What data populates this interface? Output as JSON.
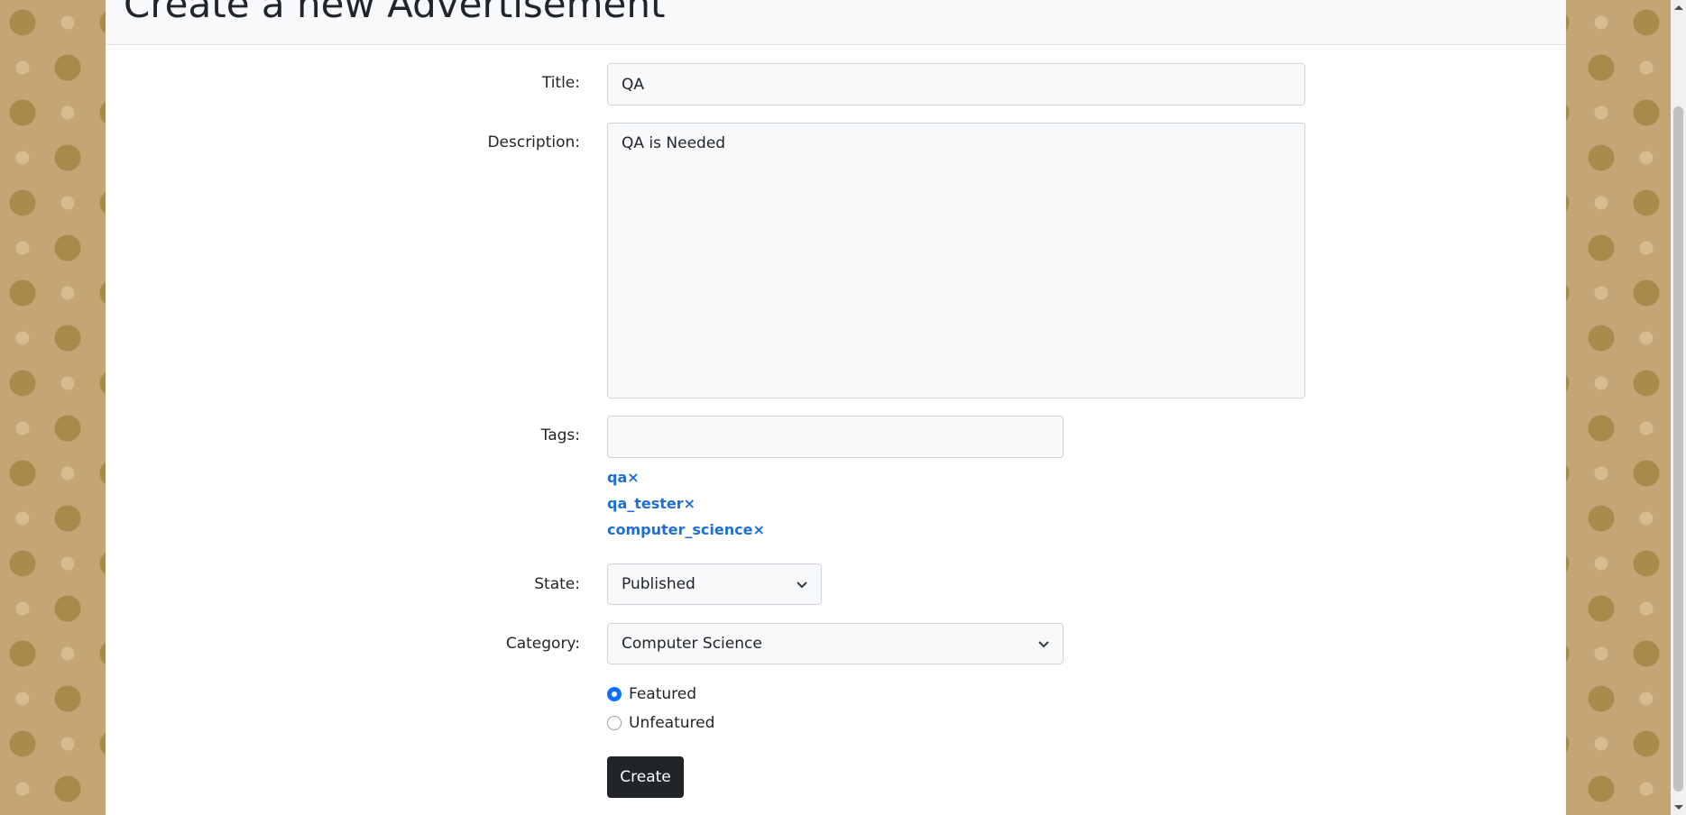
{
  "page": {
    "heading": "Create a new Advertisement"
  },
  "form": {
    "title_label": "Title:",
    "title_value": "QA",
    "description_label": "Description:",
    "description_value": "QA is Needed",
    "tags_label": "Tags:",
    "tags_value": "",
    "tags": [
      "qa×",
      "qa_tester×",
      "computer_science×"
    ],
    "state_label": "State:",
    "state_value": "Published",
    "category_label": "Category:",
    "category_value": "Computer Science",
    "featured_label": "Featured",
    "featured_checked": true,
    "unfeatured_label": "Unfeatured",
    "create_button": "Create"
  },
  "colors": {
    "accent": "#0d6efd",
    "tag_link": "#1d6fd6",
    "button_bg": "#212529",
    "input_bg": "#f8f9fa"
  }
}
